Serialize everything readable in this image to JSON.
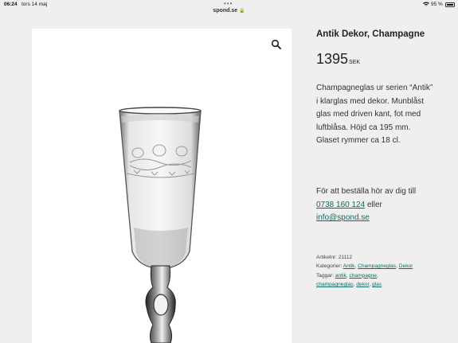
{
  "status_bar": {
    "time": "06:24",
    "date": "tors 14 maj",
    "battery": "95 %"
  },
  "browser": {
    "domain": "spond.se"
  },
  "product": {
    "title": "Antik Dekor, Champagne",
    "price": "1395",
    "currency": "SEK",
    "description": "Champagneglas ur serien “Antik” i klarglas med dekor. Munblåst glas med driven kant, fot med luftblåsa. Höjd ca 195 mm. Glaset rymmer ca  18 cl.",
    "order_prefix": "För att beställa hör av dig till",
    "phone": "0738 160 124",
    "order_or": " eller",
    "email": "info@spond.se",
    "article_label": "Artikelnr: ",
    "article_number": "21112",
    "categories_label": "Kategorier: ",
    "categories": [
      "Antik",
      "Champagneglas",
      "Dekor"
    ],
    "tags_label": "Taggar: ",
    "tags": [
      "antik",
      "champagne",
      "champagneglas",
      "dekor",
      "glas"
    ]
  },
  "colors": {
    "link": "#0e6a63",
    "page_background": "#efefef",
    "image_background": "#ffffff"
  },
  "icons": {
    "zoom": "magnifier-icon",
    "lock": "lock-icon",
    "wifi": "wifi-icon",
    "battery": "battery-icon"
  }
}
